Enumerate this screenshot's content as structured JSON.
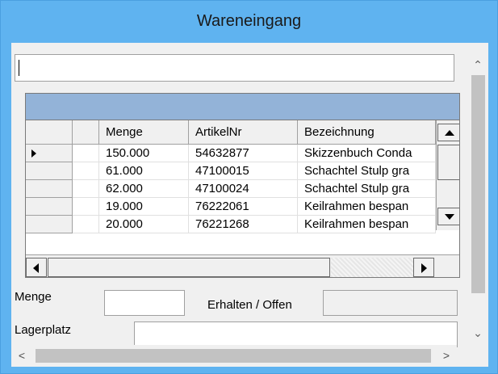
{
  "window": {
    "title": "Wareneingang"
  },
  "search": {
    "value": ""
  },
  "grid": {
    "columns": [
      "Menge",
      "ArtikelNr",
      "Bezeichnung"
    ],
    "rows": [
      {
        "menge": "150.000",
        "artikelnr": "54632877",
        "bezeichnung": "Skizzenbuch Conda"
      },
      {
        "menge": "61.000",
        "artikelnr": "47100015",
        "bezeichnung": "Schachtel Stulp gra"
      },
      {
        "menge": "62.000",
        "artikelnr": "47100024",
        "bezeichnung": "Schachtel Stulp gra"
      },
      {
        "menge": "19.000",
        "artikelnr": "76222061",
        "bezeichnung": "Keilrahmen bespan"
      },
      {
        "menge": "20.000",
        "artikelnr": "76221268",
        "bezeichnung": "Keilrahmen bespan"
      }
    ],
    "current_row_index": 0
  },
  "form": {
    "menge_label": "Menge",
    "menge_value": "",
    "erhalten_label": "Erhalten / Offen",
    "erhalten_value": "",
    "lagerplatz_label": "Lagerplatz",
    "lagerplatz_value": ""
  },
  "icons": {
    "scroll_up": "chevron-up-icon",
    "scroll_down": "chevron-down-icon",
    "scroll_left": "chevron-left-icon",
    "scroll_right": "chevron-right-icon",
    "row_selector": "row-pointer-icon"
  },
  "colors": {
    "title_bar": "#5fb3f0",
    "grid_caption": "#93b3d8"
  }
}
